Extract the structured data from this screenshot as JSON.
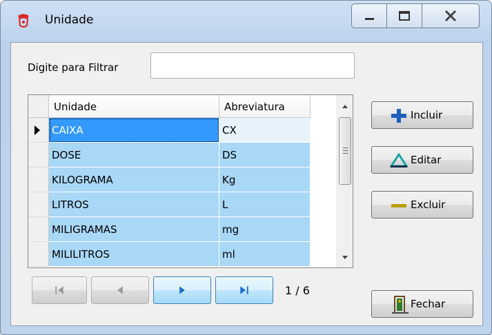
{
  "window": {
    "title": "Unidade"
  },
  "filter": {
    "label": "Digite para Filtrar",
    "value": "",
    "placeholder": ""
  },
  "grid": {
    "columns": [
      "Unidade",
      "Abreviatura"
    ],
    "rows": [
      {
        "unidade": "CAIXA",
        "abreviatura": "CX",
        "selected": true
      },
      {
        "unidade": "DOSE",
        "abreviatura": "DS"
      },
      {
        "unidade": "KILOGRAMA",
        "abreviatura": "Kg"
      },
      {
        "unidade": "LITROS",
        "abreviatura": "L"
      },
      {
        "unidade": "MILIGRAMAS",
        "abreviatura": "mg"
      },
      {
        "unidade": "MILILITROS",
        "abreviatura": "ml"
      }
    ]
  },
  "buttons": {
    "incluir": {
      "label": "Incluir",
      "icon": "plus-icon"
    },
    "editar": {
      "label": "Editar",
      "icon": "triangle-icon"
    },
    "excluir": {
      "label": "Excluir",
      "icon": "minus-icon"
    },
    "fechar": {
      "label": "Fechar",
      "icon": "door-exit-icon"
    }
  },
  "navigation": {
    "page_indicator": "1 / 6"
  },
  "colors": {
    "selection": "#3399ff",
    "row": "#a9d7f6",
    "plus": "#1f5fbf",
    "triangle": "#1aa3a3",
    "minus": "#b8a000"
  }
}
